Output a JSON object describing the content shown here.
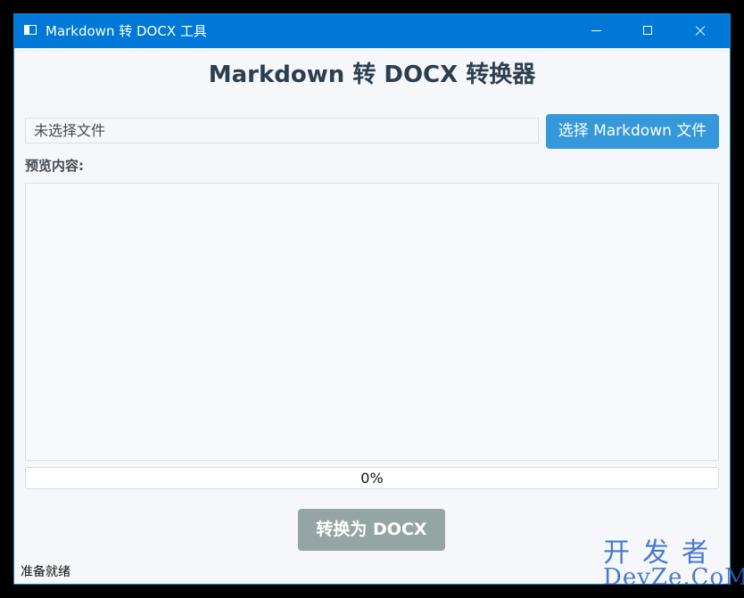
{
  "window": {
    "title": "Markdown 转 DOCX 工具",
    "app_icon": "window-app-icon",
    "controls": {
      "minimize_icon": "minimize-icon",
      "maximize_icon": "maximize-icon",
      "close_icon": "close-icon"
    },
    "accent_color": "#0078d7"
  },
  "main": {
    "heading": "Markdown 转 DOCX 转换器",
    "file_path": "未选择文件",
    "select_button": "选择 Markdown 文件",
    "preview_label": "预览内容:",
    "preview_content": "",
    "progress": {
      "value": 0,
      "text": "0%"
    },
    "convert_button": "转换为 DOCX"
  },
  "status_bar": {
    "text": "准备就绪"
  },
  "watermark": {
    "line1": "开发者",
    "line2": "DevZe.CoM"
  },
  "colors": {
    "primary_button": "#3498db",
    "disabled_button": "#95a5a6",
    "heading": "#2c3e50"
  }
}
